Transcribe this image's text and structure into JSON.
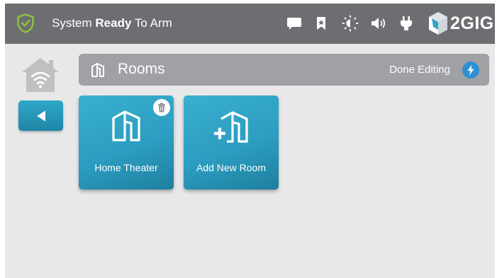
{
  "statusbar": {
    "status_prefix": "System ",
    "status_bold": "Ready",
    "status_suffix": " To Arm",
    "icons": [
      "shield-check-icon",
      "message-icon",
      "bookmark-icon",
      "brightness-icon",
      "volume-icon",
      "power-plug-icon"
    ],
    "brand": "2GIG"
  },
  "header": {
    "title": "Rooms",
    "done_label": "Done Editing"
  },
  "rooms": [
    {
      "label": "Home Theater",
      "deletable": true
    },
    {
      "label": "Add New Room",
      "deletable": false
    }
  ],
  "colors": {
    "topbar": "#6d6e71",
    "header": "#9fa1a4",
    "tile": "#2c9ec1",
    "accent_blue": "#2f8fd3",
    "background": "#e8e8e9",
    "shield_green": "#8bc53f"
  }
}
